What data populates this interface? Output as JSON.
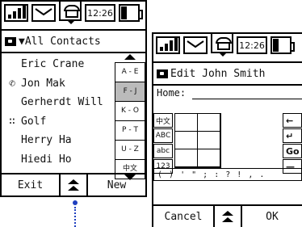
{
  "screen1": {
    "status": {
      "time": "12:26"
    },
    "title": "▼All Contacts",
    "contacts": [
      {
        "name": "Eric Crane",
        "icon": ""
      },
      {
        "name": "Jon Mak",
        "icon": "phone-small-icon"
      },
      {
        "name": "Gerherdt Will",
        "icon": ""
      },
      {
        "name": "Golf",
        "icon": "group-icon"
      },
      {
        "name": "Herry Ha",
        "icon": ""
      },
      {
        "name": "Hiedi Ho",
        "icon": ""
      }
    ],
    "alpha_tabs": [
      "A - E",
      "F - J",
      "K - O",
      "P - T",
      "U - Z",
      "中文"
    ],
    "selected_tab": "F - J",
    "softkeys": {
      "left": "Exit",
      "right": "New"
    }
  },
  "screen2": {
    "status": {
      "time": "12:26"
    },
    "title": "Edit John Smith",
    "field_label": "Home:",
    "ime_left_keys": [
      "中文",
      "ABC",
      "abc",
      "123"
    ],
    "ime_right_keys": [
      "←",
      "↵",
      "Go",
      "—"
    ],
    "punctuation": "( ) ' \" ; : ? ! , .",
    "softkeys": {
      "left": "Cancel",
      "right": "OK"
    }
  },
  "colors": {
    "pointer": "#1f3fbf",
    "selected_tab": "#bbbbbb"
  }
}
